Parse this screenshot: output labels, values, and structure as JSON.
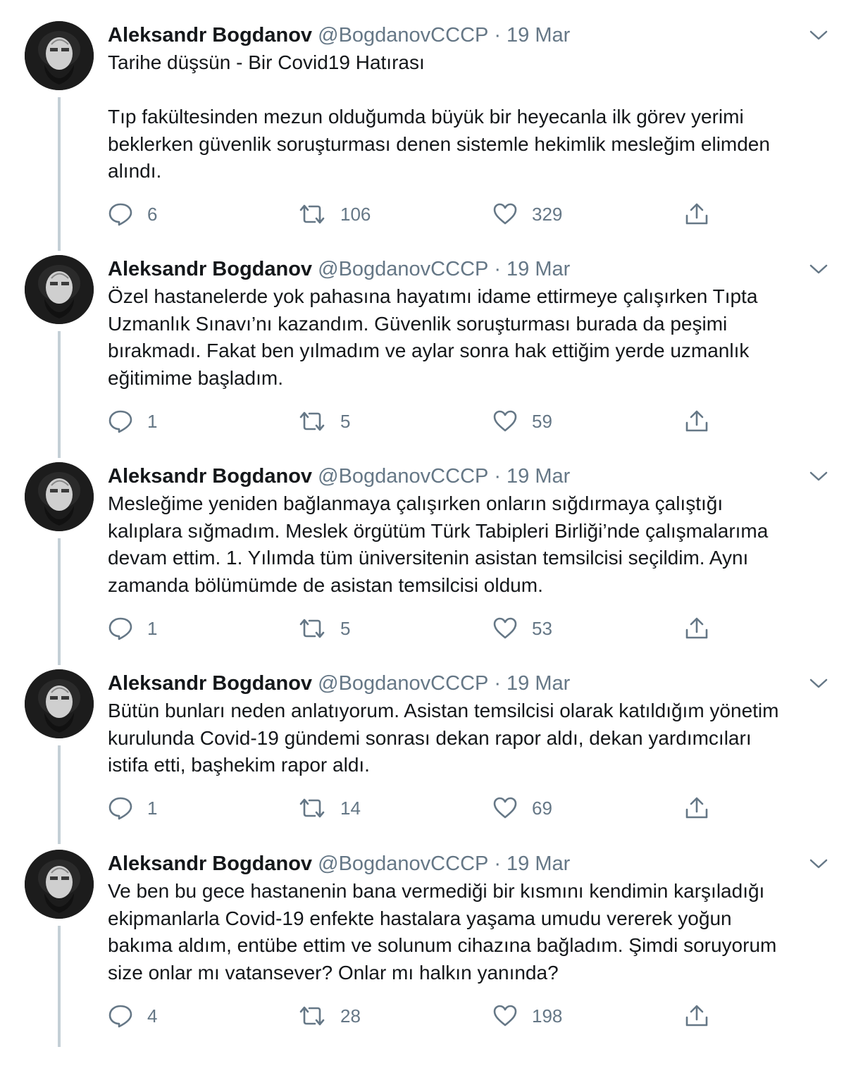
{
  "tweets": [
    {
      "author": "Aleksandr Bogdanov",
      "handle": "@BogdanovCCCP",
      "separator": "·",
      "date": "19 Mar",
      "text": "Tarihe düşsün - Bir Covid19 Hatırası\n\nTıp fakültesinden mezun olduğumda büyük bir heyecanla ilk görev yerimi\nbeklerken güvenlik soruşturması denen sistemle hekimlik mesleğim elimden\nalındı.",
      "replies": "6",
      "retweets": "106",
      "likes": "329"
    },
    {
      "author": "Aleksandr Bogdanov",
      "handle": "@BogdanovCCCP",
      "separator": "·",
      "date": "19 Mar",
      "text": "Özel hastanelerde yok pahasına hayatımı idame ettirmeye çalışırken Tıpta\nUzmanlık Sınavı’nı kazandım. Güvenlik soruşturması burada da peşimi\nbırakmadı. Fakat ben yılmadım ve aylar sonra hak ettiğim yerde uzmanlık\neğitimime başladım.",
      "replies": "1",
      "retweets": "5",
      "likes": "59"
    },
    {
      "author": "Aleksandr Bogdanov",
      "handle": "@BogdanovCCCP",
      "separator": "·",
      "date": "19 Mar",
      "text": "Mesleğime yeniden bağlanmaya çalışırken onların sığdırmaya çalıştığı\nkalıplara sığmadım. Meslek örgütüm Türk Tabipleri Birliği’nde çalışmalarıma\ndevam ettim. 1. Yılımda tüm üniversitenin asistan temsilcisi seçildim. Aynı\nzamanda bölümümde de asistan temsilcisi oldum.",
      "replies": "1",
      "retweets": "5",
      "likes": "53"
    },
    {
      "author": "Aleksandr Bogdanov",
      "handle": "@BogdanovCCCP",
      "separator": "·",
      "date": "19 Mar",
      "text": "Bütün bunları neden anlatıyorum. Asistan temsilcisi olarak katıldığım yönetim\nkurulunda Covid-19 gündemi sonrası dekan rapor aldı, dekan yardımcıları\nistifa etti, başhekim rapor aldı.",
      "replies": "1",
      "retweets": "14",
      "likes": "69"
    },
    {
      "author": "Aleksandr Bogdanov",
      "handle": "@BogdanovCCCP",
      "separator": "·",
      "date": "19 Mar",
      "text": "Ve ben bu gece hastanenin bana vermediği bir kısmını kendimin karşıladığı\nekipmanlarla Covid-19 enfekte hastalara yaşama umudu vererek yoğun\nbakıma aldım, entübe ettim ve solunum cihazına bağladım. Şimdi soruyorum\nsize onlar mı vatansever? Onlar mı halkın yanında?",
      "replies": "4",
      "retweets": "28",
      "likes": "198"
    }
  ],
  "icons": {
    "reply": "reply-icon",
    "retweet": "retweet-icon",
    "like": "heart-icon",
    "share": "share-icon",
    "menu": "chevron-down-icon"
  },
  "colors": {
    "text": "#14171a",
    "secondary": "#657786",
    "thread_line": "#c4cfd6"
  }
}
